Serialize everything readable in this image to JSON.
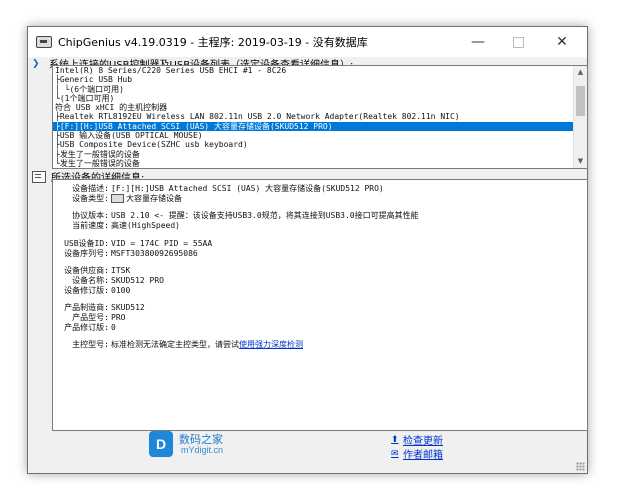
{
  "window": {
    "title": "ChipGenius v4.19.0319 - 主程序: 2019-03-19 - 没有数据库",
    "minimize_glyph": "—",
    "close_glyph": "✕"
  },
  "device_section": {
    "header": "系统上连接的USB控制器及USB设备列表（选定设备查看详细信息）:",
    "icon": "chevron-down-icon",
    "rows": [
      "Intel(R) 8 Series/C220 Series USB EHCI #1 - 8C26",
      "├Generic USB Hub",
      "│ └(6个端口可用)",
      "└(1个端口可用)",
      "符合 USB xHCI 的主机控制器",
      "├Realtek RTL8192EU Wireless LAN 802.11n USB 2.0 Network Adapter(Realtek 802.11n NIC)",
      "├[F:][H:]USB Attached SCSI (UAS) 大容量存储设备(SKUD512 PRO)",
      "├USB 输入设备(USB OPTICAL MOUSE)",
      "├USB Composite Device(SZHC usb keyboard)",
      "├发生了一般错误的设备",
      "└发生了一般错误的设备"
    ],
    "selected_index": 6
  },
  "detail_section": {
    "header": "所选设备的详细信息:",
    "icon": "document-icon",
    "rows": [
      {
        "label": "设备描述:",
        "value": "[F:][H:]USB Attached SCSI (UAS) 大容量存储设备(SKUD512 PRO)"
      },
      {
        "label": "设备类型:",
        "value": "大容量存储设备"
      },
      {
        "label": "协议版本:",
        "value": "USB 2.10 <- 提醒：该设备支持USB3.0规范，将其连接到USB3.0接口可提高其性能"
      },
      {
        "label": "当前速度:",
        "value": "高速(HighSpeed)"
      },
      {
        "label": "USB设备ID:",
        "value": "VID = 174C PID = 55AA"
      },
      {
        "label": "设备序列号:",
        "value": "MSFT30380092695086"
      },
      {
        "label": "设备供应商:",
        "value": "ITSK"
      },
      {
        "label": "设备名称:",
        "value": "SKUD512 PRO"
      },
      {
        "label": "设备修订版:",
        "value": "0100"
      },
      {
        "label": "产品制造商:",
        "value": "SKUD512"
      },
      {
        "label": "产品型号:",
        "value": "PRO"
      },
      {
        "label": "产品修订版:",
        "value": "0"
      },
      {
        "label": "主控型号:",
        "value": "标准检测无法确定主控类型，请尝试",
        "link": "使用强力深度检测"
      }
    ]
  },
  "footer": {
    "brand_cn": "数码之家",
    "brand_en": "mYdigit.cn",
    "logo_letter": "D",
    "check_update": "检查更新",
    "author_email": "作者邮箱"
  }
}
